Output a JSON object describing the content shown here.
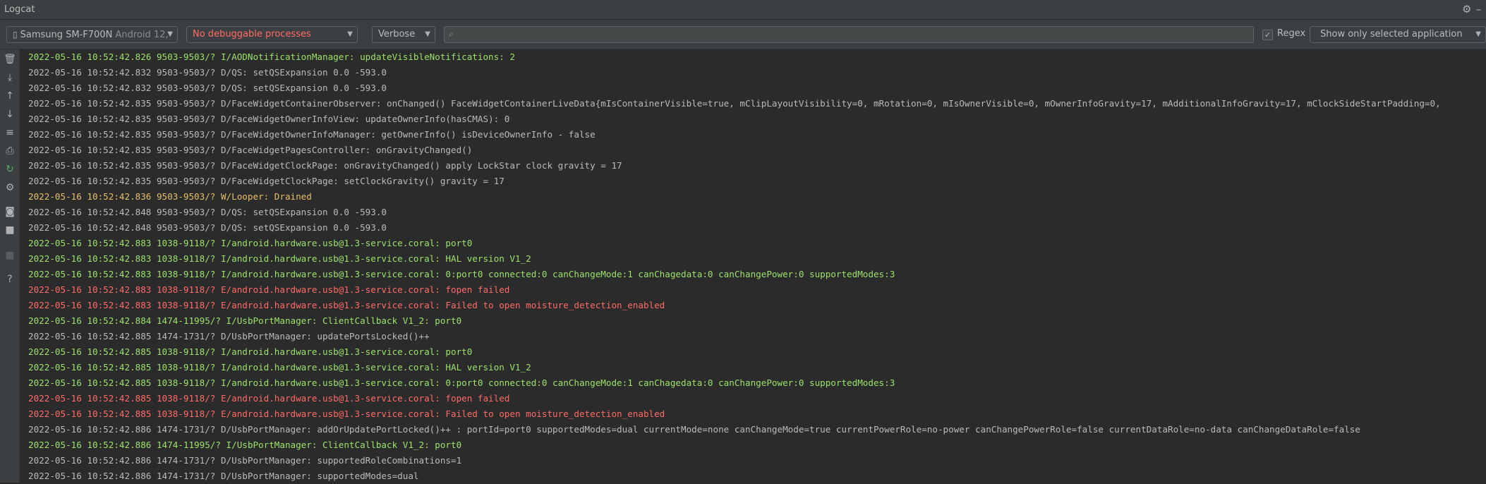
{
  "title": "Logcat",
  "toolbar": {
    "device": "Samsung SM-F700N",
    "device_detail": "Android 12,",
    "process": "No debuggable processes",
    "log_level": "Verbose",
    "search_value": "",
    "regex_label": "Regex",
    "regex_checked": true,
    "filter": "Show only selected application"
  },
  "colors": {
    "info": "#9ce26d",
    "debug": "#bbbbbb",
    "warn": "#e8bf6a",
    "error": "#ff6b68"
  },
  "logs": [
    {
      "level": "I",
      "text": "2022-05-16 10:52:42.826 9503-9503/? I/AODNotificationManager: updateVisibleNotifications: 2"
    },
    {
      "level": "D",
      "text": "2022-05-16 10:52:42.832 9503-9503/? D/QS: setQSExpansion 0.0 -593.0"
    },
    {
      "level": "D",
      "text": "2022-05-16 10:52:42.832 9503-9503/? D/QS: setQSExpansion 0.0 -593.0"
    },
    {
      "level": "D",
      "text": "2022-05-16 10:52:42.835 9503-9503/? D/FaceWidgetContainerObserver: onChanged() FaceWidgetContainerLiveData{mIsContainerVisible=true, mClipLayoutVisibility=0, mRotation=0, mIsOwnerVisible=0, mOwnerInfoGravity=17, mAdditionalInfoGravity=17, mClockSideStartPadding=0,"
    },
    {
      "level": "D",
      "text": "2022-05-16 10:52:42.835 9503-9503/? D/FaceWidgetOwnerInfoView: updateOwnerInfo(hasCMAS): 0"
    },
    {
      "level": "D",
      "text": "2022-05-16 10:52:42.835 9503-9503/? D/FaceWidgetOwnerInfoManager: getOwnerInfo() isDeviceOwnerInfo - false"
    },
    {
      "level": "D",
      "text": "2022-05-16 10:52:42.835 9503-9503/? D/FaceWidgetPagesController: onGravityChanged()"
    },
    {
      "level": "D",
      "text": "2022-05-16 10:52:42.835 9503-9503/? D/FaceWidgetClockPage: onGravityChanged() apply LockStar clock gravity = 17"
    },
    {
      "level": "D",
      "text": "2022-05-16 10:52:42.835 9503-9503/? D/FaceWidgetClockPage: setClockGravity() gravity = 17"
    },
    {
      "level": "W",
      "text": "2022-05-16 10:52:42.836 9503-9503/? W/Looper: Drained"
    },
    {
      "level": "D",
      "text": "2022-05-16 10:52:42.848 9503-9503/? D/QS: setQSExpansion 0.0 -593.0"
    },
    {
      "level": "D",
      "text": "2022-05-16 10:52:42.848 9503-9503/? D/QS: setQSExpansion 0.0 -593.0"
    },
    {
      "level": "I",
      "text": "2022-05-16 10:52:42.883 1038-9118/? I/android.hardware.usb@1.3-service.coral: port0"
    },
    {
      "level": "I",
      "text": "2022-05-16 10:52:42.883 1038-9118/? I/android.hardware.usb@1.3-service.coral: HAL version V1_2"
    },
    {
      "level": "I",
      "text": "2022-05-16 10:52:42.883 1038-9118/? I/android.hardware.usb@1.3-service.coral: 0:port0 connected:0 canChangeMode:1 canChagedata:0 canChangePower:0 supportedModes:3"
    },
    {
      "level": "E",
      "text": "2022-05-16 10:52:42.883 1038-9118/? E/android.hardware.usb@1.3-service.coral: fopen failed"
    },
    {
      "level": "E",
      "text": "2022-05-16 10:52:42.883 1038-9118/? E/android.hardware.usb@1.3-service.coral: Failed to open moisture_detection_enabled"
    },
    {
      "level": "I",
      "text": "2022-05-16 10:52:42.884 1474-11995/? I/UsbPortManager: ClientCallback V1_2: port0"
    },
    {
      "level": "D",
      "text": "2022-05-16 10:52:42.885 1474-1731/? D/UsbPortManager: updatePortsLocked()++"
    },
    {
      "level": "I",
      "text": "2022-05-16 10:52:42.885 1038-9118/? I/android.hardware.usb@1.3-service.coral: port0"
    },
    {
      "level": "I",
      "text": "2022-05-16 10:52:42.885 1038-9118/? I/android.hardware.usb@1.3-service.coral: HAL version V1_2"
    },
    {
      "level": "I",
      "text": "2022-05-16 10:52:42.885 1038-9118/? I/android.hardware.usb@1.3-service.coral: 0:port0 connected:0 canChangeMode:1 canChagedata:0 canChangePower:0 supportedModes:3"
    },
    {
      "level": "E",
      "text": "2022-05-16 10:52:42.885 1038-9118/? E/android.hardware.usb@1.3-service.coral: fopen failed"
    },
    {
      "level": "E",
      "text": "2022-05-16 10:52:42.885 1038-9118/? E/android.hardware.usb@1.3-service.coral: Failed to open moisture_detection_enabled"
    },
    {
      "level": "D",
      "text": "2022-05-16 10:52:42.886 1474-1731/? D/UsbPortManager: addOrUpdatePortLocked()++ : portId=port0 supportedModes=dual currentMode=none canChangeMode=true currentPowerRole=no-power canChangePowerRole=false currentDataRole=no-data canChangeDataRole=false"
    },
    {
      "level": "I",
      "text": "2022-05-16 10:52:42.886 1474-11995/? I/UsbPortManager: ClientCallback V1_2: port0"
    },
    {
      "level": "D",
      "text": "2022-05-16 10:52:42.886 1474-1731/? D/UsbPortManager: supportedRoleCombinations=1"
    },
    {
      "level": "D",
      "text": "2022-05-16 10:52:42.886 1474-1731/? D/UsbPortManager: supportedModes=dual"
    }
  ]
}
